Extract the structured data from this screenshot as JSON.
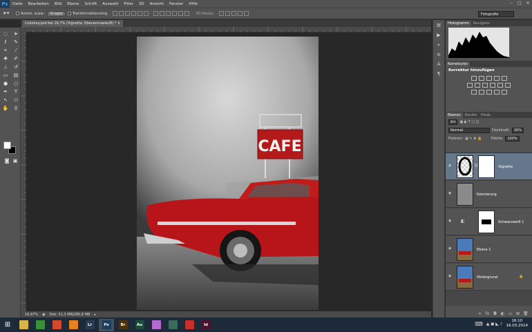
{
  "menubar": {
    "logo": "Ps",
    "items": [
      "Datei",
      "Bearbeiten",
      "Bild",
      "Ebene",
      "Schrift",
      "Auswahl",
      "Filter",
      "3D",
      "Ansicht",
      "Fenster",
      "Hilfe"
    ]
  },
  "options": {
    "auto_select_label": "Autom. ausw.:",
    "group_value": "Gruppe",
    "transform_label": "Transformationsstrg.",
    "mode_3d_label": "3D-Modus:",
    "workspace": "Fotografie"
  },
  "document": {
    "tab_title": "Colorkey.psd bei 16,7% (Vignette, Ebenenmaske/8) *",
    "zoom": "16,67%",
    "doc_size": "Dok: 51,3 MB/285,8 MB",
    "sign_text": "CAFE"
  },
  "panels": {
    "tabs_top": [
      "Histogramm",
      "Navigator"
    ],
    "tabs_korr": [
      "Korrekturen"
    ],
    "korr_title": "Korrektur hinzufügen",
    "tabs_layers": [
      "Ebenen",
      "Kanäle",
      "Pfade"
    ],
    "filter_kind": "Art",
    "blend_mode": "Normal",
    "opacity_label": "Deckkraft:",
    "opacity_value": "30%",
    "lock_label": "Fixieren:",
    "fill_label": "Fläche:",
    "fill_value": "100%"
  },
  "layers": [
    {
      "name": "Vignette",
      "selected": true
    },
    {
      "name": "Kolorierung",
      "selected": false
    },
    {
      "name": "Schwarzweiß 1",
      "selected": false
    },
    {
      "name": "Ebene 1",
      "selected": false
    },
    {
      "name": "Hintergrund",
      "selected": false
    }
  ],
  "taskbar": {
    "apps": [
      {
        "label": "",
        "color": "#d8b24a",
        "icon": "explorer-icon"
      },
      {
        "label": "",
        "color": "#3b8f3b",
        "icon": "globe-icon"
      },
      {
        "label": "",
        "color": "#d04a2b",
        "icon": "chrome-icon"
      },
      {
        "label": "",
        "color": "#e8821e",
        "icon": "vlc-icon"
      },
      {
        "label": "Lr",
        "color": "#2a3b52",
        "icon": "lightroom-icon"
      },
      {
        "label": "Ps",
        "color": "#1d3d5c",
        "icon": "photoshop-icon"
      },
      {
        "label": "Br",
        "color": "#4a3310",
        "icon": "bridge-icon"
      },
      {
        "label": "Au",
        "color": "#1e4a3a",
        "icon": "audition-icon"
      },
      {
        "label": "",
        "color": "#b36bd0",
        "icon": "app-icon"
      },
      {
        "label": "",
        "color": "#3a6a5a",
        "icon": "app2-icon"
      },
      {
        "label": "",
        "color": "#c9302c",
        "icon": "filezilla-icon"
      },
      {
        "label": "Id",
        "color": "#4a1230",
        "icon": "indesign-icon"
      }
    ],
    "time": "16:10",
    "date": "16.03.2014"
  }
}
